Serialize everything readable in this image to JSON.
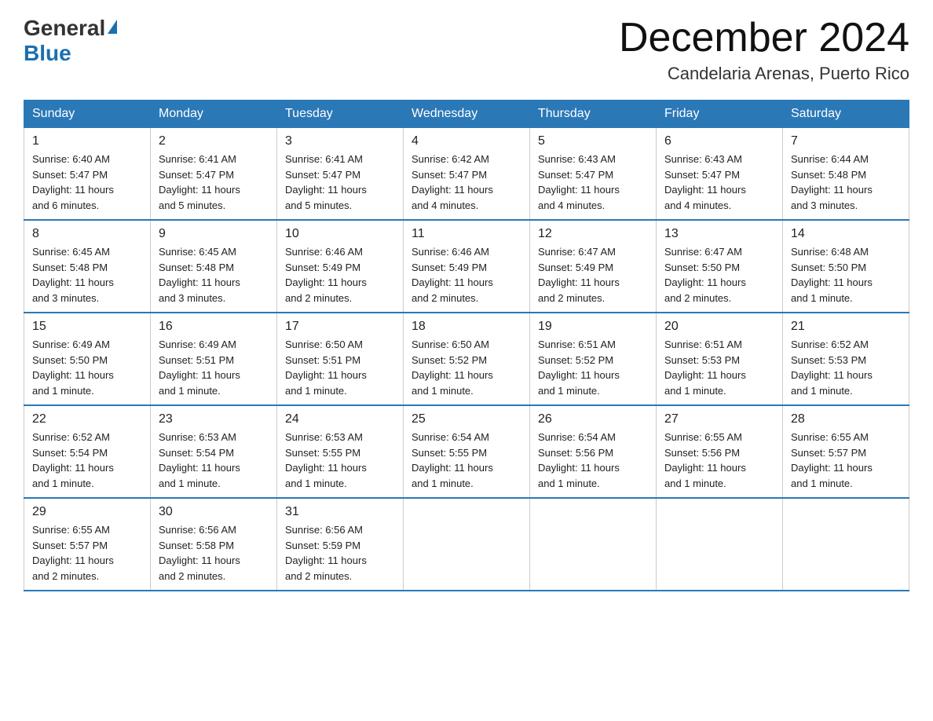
{
  "logo": {
    "general": "General",
    "blue": "Blue"
  },
  "header": {
    "month": "December 2024",
    "location": "Candelaria Arenas, Puerto Rico"
  },
  "weekdays": [
    "Sunday",
    "Monday",
    "Tuesday",
    "Wednesday",
    "Thursday",
    "Friday",
    "Saturday"
  ],
  "weeks": [
    [
      {
        "day": "1",
        "sunrise": "6:40 AM",
        "sunset": "5:47 PM",
        "daylight": "11 hours and 6 minutes."
      },
      {
        "day": "2",
        "sunrise": "6:41 AM",
        "sunset": "5:47 PM",
        "daylight": "11 hours and 5 minutes."
      },
      {
        "day": "3",
        "sunrise": "6:41 AM",
        "sunset": "5:47 PM",
        "daylight": "11 hours and 5 minutes."
      },
      {
        "day": "4",
        "sunrise": "6:42 AM",
        "sunset": "5:47 PM",
        "daylight": "11 hours and 4 minutes."
      },
      {
        "day": "5",
        "sunrise": "6:43 AM",
        "sunset": "5:47 PM",
        "daylight": "11 hours and 4 minutes."
      },
      {
        "day": "6",
        "sunrise": "6:43 AM",
        "sunset": "5:47 PM",
        "daylight": "11 hours and 4 minutes."
      },
      {
        "day": "7",
        "sunrise": "6:44 AM",
        "sunset": "5:48 PM",
        "daylight": "11 hours and 3 minutes."
      }
    ],
    [
      {
        "day": "8",
        "sunrise": "6:45 AM",
        "sunset": "5:48 PM",
        "daylight": "11 hours and 3 minutes."
      },
      {
        "day": "9",
        "sunrise": "6:45 AM",
        "sunset": "5:48 PM",
        "daylight": "11 hours and 3 minutes."
      },
      {
        "day": "10",
        "sunrise": "6:46 AM",
        "sunset": "5:49 PM",
        "daylight": "11 hours and 2 minutes."
      },
      {
        "day": "11",
        "sunrise": "6:46 AM",
        "sunset": "5:49 PM",
        "daylight": "11 hours and 2 minutes."
      },
      {
        "day": "12",
        "sunrise": "6:47 AM",
        "sunset": "5:49 PM",
        "daylight": "11 hours and 2 minutes."
      },
      {
        "day": "13",
        "sunrise": "6:47 AM",
        "sunset": "5:50 PM",
        "daylight": "11 hours and 2 minutes."
      },
      {
        "day": "14",
        "sunrise": "6:48 AM",
        "sunset": "5:50 PM",
        "daylight": "11 hours and 1 minute."
      }
    ],
    [
      {
        "day": "15",
        "sunrise": "6:49 AM",
        "sunset": "5:50 PM",
        "daylight": "11 hours and 1 minute."
      },
      {
        "day": "16",
        "sunrise": "6:49 AM",
        "sunset": "5:51 PM",
        "daylight": "11 hours and 1 minute."
      },
      {
        "day": "17",
        "sunrise": "6:50 AM",
        "sunset": "5:51 PM",
        "daylight": "11 hours and 1 minute."
      },
      {
        "day": "18",
        "sunrise": "6:50 AM",
        "sunset": "5:52 PM",
        "daylight": "11 hours and 1 minute."
      },
      {
        "day": "19",
        "sunrise": "6:51 AM",
        "sunset": "5:52 PM",
        "daylight": "11 hours and 1 minute."
      },
      {
        "day": "20",
        "sunrise": "6:51 AM",
        "sunset": "5:53 PM",
        "daylight": "11 hours and 1 minute."
      },
      {
        "day": "21",
        "sunrise": "6:52 AM",
        "sunset": "5:53 PM",
        "daylight": "11 hours and 1 minute."
      }
    ],
    [
      {
        "day": "22",
        "sunrise": "6:52 AM",
        "sunset": "5:54 PM",
        "daylight": "11 hours and 1 minute."
      },
      {
        "day": "23",
        "sunrise": "6:53 AM",
        "sunset": "5:54 PM",
        "daylight": "11 hours and 1 minute."
      },
      {
        "day": "24",
        "sunrise": "6:53 AM",
        "sunset": "5:55 PM",
        "daylight": "11 hours and 1 minute."
      },
      {
        "day": "25",
        "sunrise": "6:54 AM",
        "sunset": "5:55 PM",
        "daylight": "11 hours and 1 minute."
      },
      {
        "day": "26",
        "sunrise": "6:54 AM",
        "sunset": "5:56 PM",
        "daylight": "11 hours and 1 minute."
      },
      {
        "day": "27",
        "sunrise": "6:55 AM",
        "sunset": "5:56 PM",
        "daylight": "11 hours and 1 minute."
      },
      {
        "day": "28",
        "sunrise": "6:55 AM",
        "sunset": "5:57 PM",
        "daylight": "11 hours and 1 minute."
      }
    ],
    [
      {
        "day": "29",
        "sunrise": "6:55 AM",
        "sunset": "5:57 PM",
        "daylight": "11 hours and 2 minutes."
      },
      {
        "day": "30",
        "sunrise": "6:56 AM",
        "sunset": "5:58 PM",
        "daylight": "11 hours and 2 minutes."
      },
      {
        "day": "31",
        "sunrise": "6:56 AM",
        "sunset": "5:59 PM",
        "daylight": "11 hours and 2 minutes."
      },
      null,
      null,
      null,
      null
    ]
  ],
  "labels": {
    "sunrise": "Sunrise:",
    "sunset": "Sunset:",
    "daylight": "Daylight:"
  }
}
